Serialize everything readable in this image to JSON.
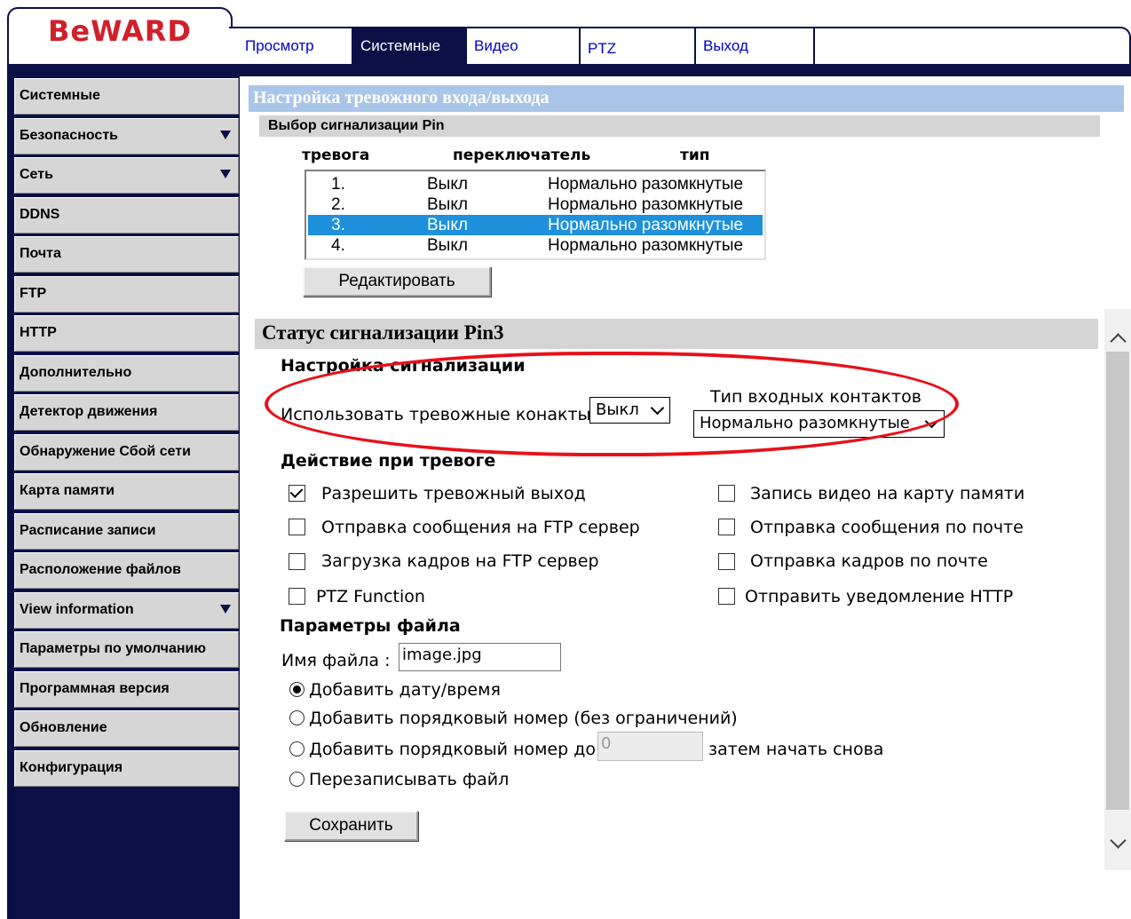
{
  "header": {
    "logo_text": "BeWARD",
    "tabs": [
      {
        "label": "Просмотр"
      },
      {
        "label": "Системные"
      },
      {
        "label": "Видео"
      },
      {
        "label": "PTZ"
      },
      {
        "label": "Выход"
      }
    ],
    "active_tab": "Системные"
  },
  "sidebar": {
    "items": [
      {
        "label": "Системные",
        "has_arrow": false
      },
      {
        "label": "Безопасность",
        "has_arrow": true
      },
      {
        "label": "Сеть",
        "has_arrow": true
      },
      {
        "label": "DDNS",
        "has_arrow": false
      },
      {
        "label": "Почта",
        "has_arrow": false
      },
      {
        "label": "FTP",
        "has_arrow": false
      },
      {
        "label": "HTTP",
        "has_arrow": false
      },
      {
        "label": "Дополнительно",
        "has_arrow": false
      },
      {
        "label": "Детектор движения",
        "has_arrow": false
      },
      {
        "label": "Обнаружение Сбой сети",
        "has_arrow": false
      },
      {
        "label": "Карта памяти",
        "has_arrow": false
      },
      {
        "label": "Расписание записи",
        "has_arrow": false
      },
      {
        "label": "Расположение файлов",
        "has_arrow": false
      },
      {
        "label": "View information",
        "has_arrow": true
      },
      {
        "label": "Параметры по умолчанию",
        "has_arrow": false
      },
      {
        "label": "Программная версия",
        "has_arrow": false
      },
      {
        "label": "Обновление",
        "has_arrow": false
      },
      {
        "label": "Конфигурация",
        "has_arrow": false
      }
    ]
  },
  "main": {
    "title": "Настройка тревожного входа/выхода",
    "pin_select_title": "Выбор сигнализации Pin",
    "columns": {
      "alarm": "тревога",
      "switch": "переключатель",
      "type": "тип"
    },
    "rows": [
      {
        "num": "1.",
        "switch": "Выкл",
        "type": "Нормально разомкнутые",
        "selected": false
      },
      {
        "num": "2.",
        "switch": "Выкл",
        "type": "Нормально разомкнутые",
        "selected": false
      },
      {
        "num": "3.",
        "switch": "Выкл",
        "type": "Нормально разомкнутые",
        "selected": true
      },
      {
        "num": "4.",
        "switch": "Выкл",
        "type": "Нормально разомкнутые",
        "selected": false
      }
    ],
    "edit_button": "Редактировать",
    "status_title": "Статус сигнализации Pin3",
    "alarm_settings": {
      "title": "Настройка сигнализации",
      "use_contacts_label": "Использовать тревожные конакты",
      "use_contacts_value": "Выкл",
      "input_type_label": "Тип входных контактов",
      "input_type_value": "Нормально разомкнутые"
    },
    "actions": {
      "title": "Действие при тревоге",
      "items": [
        {
          "label": "Разрешить тревожный выход",
          "checked": true
        },
        {
          "label": "Запись видео на карту памяти",
          "checked": false
        },
        {
          "label": "Отправка сообщения на FTP сервер",
          "checked": false
        },
        {
          "label": "Отправка сообщения по почте",
          "checked": false
        },
        {
          "label": "Загрузка кадров на FTP сервер",
          "checked": false
        },
        {
          "label": "Отправка кадров по почте",
          "checked": false
        },
        {
          "label": "PTZ Function",
          "checked": false
        },
        {
          "label": "Отправить уведомление HTTP",
          "checked": false
        }
      ]
    },
    "file_params": {
      "title": "Параметры файла",
      "filename_label": "Имя файла :",
      "filename_value": "image.jpg",
      "options": [
        {
          "label": "Добавить дату/время",
          "selected": true
        },
        {
          "label": "Добавить порядковый номер (без ограничений)",
          "selected": false
        },
        {
          "label": "Добавить порядковый номер до",
          "selected": false
        },
        {
          "label": "Перезаписывать файл",
          "selected": false
        }
      ],
      "limit_value": "0",
      "restart_label": "затем начать снова"
    },
    "save_button": "Сохранить"
  }
}
